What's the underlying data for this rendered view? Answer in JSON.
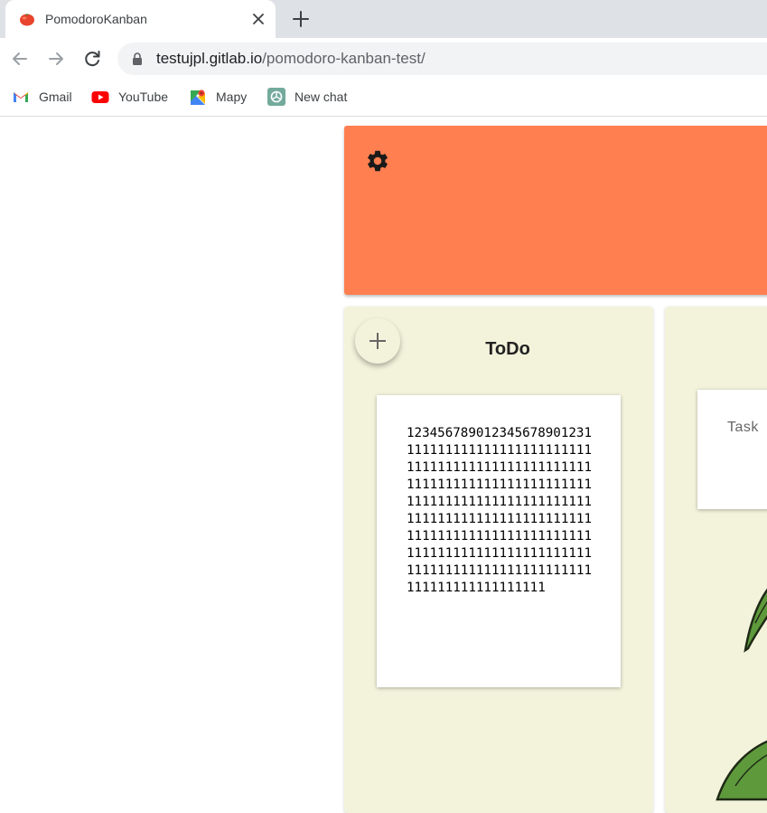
{
  "browser": {
    "tab_title": "PomodoroKanban",
    "url_host": "testujpl.gitlab.io",
    "url_path": "/pomodoro-kanban-test/",
    "bookmarks": [
      {
        "label": "Gmail",
        "icon": "gmail-icon"
      },
      {
        "label": "YouTube",
        "icon": "youtube-icon"
      },
      {
        "label": "Mapy",
        "icon": "maps-icon"
      },
      {
        "label": "New chat",
        "icon": "chatgpt-icon"
      }
    ]
  },
  "header": {
    "color": "#ff7f50",
    "settings_icon": "gear-icon"
  },
  "columns": [
    {
      "title": "ToDo",
      "add_icon": "plus-icon",
      "cards": [
        {
          "text": "123456789012345678901231111111111111111111111111111111111111111111111111111111111111111111111111111111111111111111111111111111111111111111111111111111111111111111111111111111111111111111111111111111111111111111111111111111111111111111"
        }
      ]
    },
    {
      "title": "",
      "cards": [
        {
          "text": "Task"
        }
      ]
    }
  ]
}
